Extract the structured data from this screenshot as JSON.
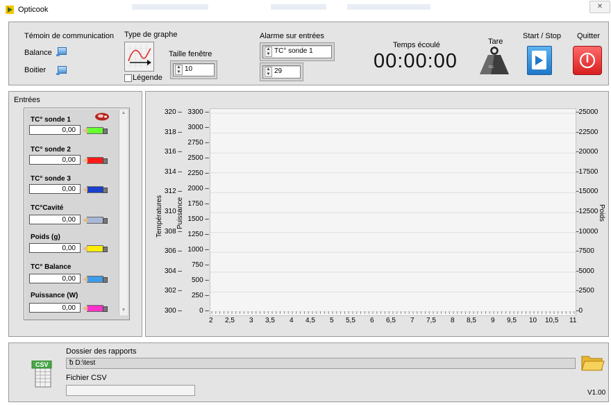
{
  "window": {
    "title": "Opticook",
    "close": "✕"
  },
  "top": {
    "comm_title": "Témoin de communication",
    "balance_label": "Balance",
    "boitier_label": "Boitier",
    "graph_type_label": "Type de graphe",
    "legend_label": "Légende",
    "window_size_label": "Taille fenêtre",
    "window_size_value": "10",
    "alarm_label": "Alarme sur entrées",
    "alarm_input": "TC° sonde 1",
    "alarm_value": "29",
    "elapsed_label": "Temps écoulé",
    "elapsed_value": "00:00:00",
    "tare_label": "Tare",
    "start_stop_label": "Start / Stop",
    "quit_label": "Quitter"
  },
  "inputs": {
    "title": "Entrées",
    "channels": [
      {
        "name": "TC° sonde 1",
        "value": "0,00",
        "color": "#66ff33"
      },
      {
        "name": "TC° sonde 2",
        "value": "0,00",
        "color": "#ff1a1a"
      },
      {
        "name": "TC° sonde 3",
        "value": "0,00",
        "color": "#1a3fcc"
      },
      {
        "name": "TC°Cavité",
        "value": "0,00",
        "color": "#a9b8d6"
      },
      {
        "name": "Poids (g)",
        "value": "0,00",
        "color": "#ffee00"
      },
      {
        "name": "TC° Balance",
        "value": "0,00",
        "color": "#3f9ce8"
      },
      {
        "name": "Puissance (W)",
        "value": "0,00",
        "color": "#ff33cc"
      }
    ]
  },
  "chart_data": {
    "type": "line",
    "x_ticks": [
      "2",
      "2,5",
      "3",
      "3,5",
      "4",
      "4,5",
      "5",
      "5,5",
      "6",
      "6,5",
      "7",
      "7,5",
      "8",
      "8,5",
      "9",
      "9,5",
      "10",
      "10,5",
      "11"
    ],
    "xlim": [
      2,
      11
    ],
    "y_temp_label": "Températures",
    "y_temp_ticks": [
      "320",
      "318",
      "316",
      "314",
      "312",
      "310",
      "308",
      "306",
      "304",
      "302",
      "300"
    ],
    "y_temp_lim": [
      300,
      320
    ],
    "y_power_label": "Puissance",
    "y_power_ticks": [
      "3300",
      "3000",
      "2750",
      "2500",
      "2250",
      "2000",
      "1750",
      "1500",
      "1250",
      "1000",
      "750",
      "500",
      "250",
      "0"
    ],
    "y_power_lim": [
      0,
      3300
    ],
    "y_weight_label": "Poids",
    "y_weight_ticks": [
      "25000",
      "22500",
      "20000",
      "17500",
      "15000",
      "12500",
      "10000",
      "7500",
      "5000",
      "2500",
      "0"
    ],
    "y_weight_lim": [
      0,
      25000
    ],
    "series": [],
    "grid": true
  },
  "bottom": {
    "reports_label": "Dossier des rapports",
    "reports_path": "D:\\test",
    "csv_label": "Fichier CSV",
    "csv_value": "",
    "csv_icon_text": "CSV",
    "version": "V1.00"
  },
  "colors": {
    "panel": "#e4e4e4",
    "start": "#2f8fd8",
    "quit": "#e02a2a"
  }
}
